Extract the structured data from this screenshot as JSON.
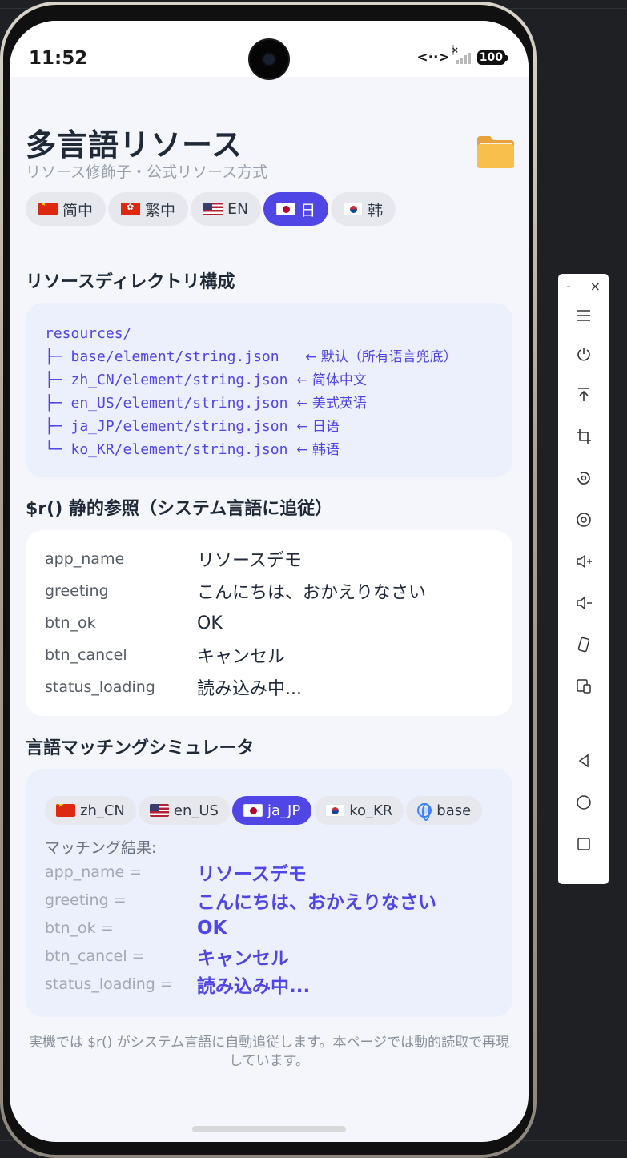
{
  "status_bar": {
    "time": "11:52",
    "network_glyph": "<··>",
    "battery": "100"
  },
  "header": {
    "title": "多言語リソース",
    "subtitle": "リソース修飾子・公式リソース方式",
    "icon": "folder-icon"
  },
  "lang_tabs": [
    {
      "label": "简中",
      "flag": "cn",
      "active": false
    },
    {
      "label": "繁中",
      "flag": "hk",
      "active": false
    },
    {
      "label": "EN",
      "flag": "us",
      "active": false
    },
    {
      "label": "日",
      "flag": "jp",
      "active": true
    },
    {
      "label": "韩",
      "flag": "kr",
      "active": false
    }
  ],
  "directory": {
    "title": "リソースディレクトリ構成",
    "lines": [
      {
        "path": "resources/",
        "note": ""
      },
      {
        "path": "├─ base/element/string.json   ",
        "note": "← 默认（所有语言兜底）"
      },
      {
        "path": "├─ zh_CN/element/string.json ",
        "note": "← 简体中文"
      },
      {
        "path": "├─ en_US/element/string.json ",
        "note": "← 美式英语"
      },
      {
        "path": "├─ ja_JP/element/string.json ",
        "note": "← 日语"
      },
      {
        "path": "└─ ko_KR/element/string.json ",
        "note": "← 韩语"
      }
    ]
  },
  "static_ref": {
    "title": "$r() 静的参照（システム言語に追従）",
    "rows": [
      {
        "key": "app_name",
        "value": "リソースデモ"
      },
      {
        "key": "greeting",
        "value": "こんにちは、おかえりなさい"
      },
      {
        "key": "btn_ok",
        "value": "OK"
      },
      {
        "key": "btn_cancel",
        "value": "キャンセル"
      },
      {
        "key": "status_loading",
        "value": "読み込み中..."
      }
    ]
  },
  "simulator": {
    "title": "言語マッチングシミュレータ",
    "tabs": [
      {
        "label": "zh_CN",
        "flag": "cn",
        "active": false
      },
      {
        "label": "en_US",
        "flag": "us",
        "active": false
      },
      {
        "label": "ja_JP",
        "flag": "jp",
        "active": true
      },
      {
        "label": "ko_KR",
        "flag": "kr",
        "active": false
      },
      {
        "label": "base",
        "flag": "globe",
        "active": false
      }
    ],
    "result_label": "マッチング結果:",
    "rows": [
      {
        "key": "app_name =",
        "value": "リソースデモ"
      },
      {
        "key": "greeting =",
        "value": "こんにちは、おかえりなさい"
      },
      {
        "key": "btn_ok =",
        "value": "OK"
      },
      {
        "key": "btn_cancel =",
        "value": "キャンセル"
      },
      {
        "key": "status_loading =",
        "value": "読み込み中..."
      }
    ]
  },
  "footnote": "実機では $r() がシステム言語に自動追従します。本ページでは動的読取で再現しています。",
  "emulator_toolbar": {
    "minimize": "-",
    "close": "×",
    "buttons": [
      "menu-icon",
      "power-icon",
      "pin-top-icon",
      "crop-icon",
      "rotate-icon",
      "screenshot-icon",
      "volume-up-icon",
      "volume-down-icon",
      "shake-icon",
      "multi-device-icon",
      "back-icon",
      "home-icon",
      "recent-apps-icon"
    ]
  },
  "colors": {
    "accent": "#4f46e5",
    "background": "#f4f6fb",
    "card_tint": "#eceffc"
  }
}
